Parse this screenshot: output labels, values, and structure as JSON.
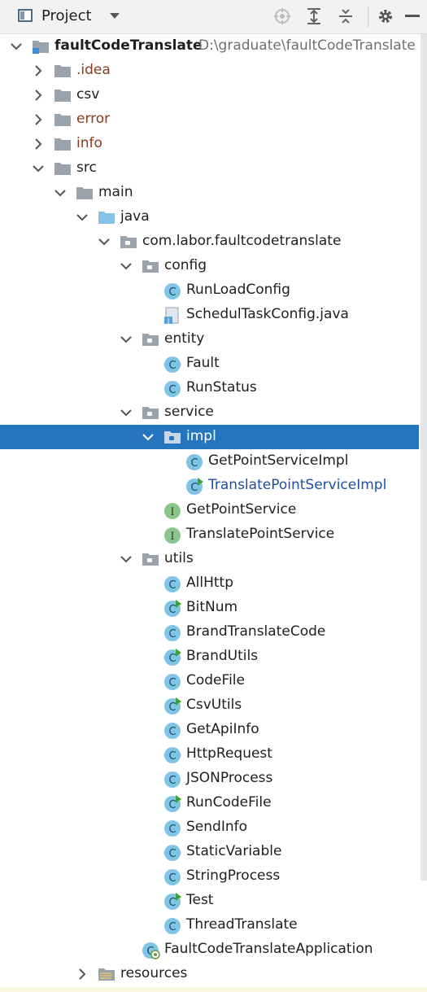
{
  "header": {
    "title": "Project"
  },
  "tree": [
    {
      "depth": 0,
      "state": "open",
      "icon": "module",
      "label": "faultCodeTranslate",
      "path": "D:\\graduate\\faultCodeTranslate",
      "style": "bold"
    },
    {
      "depth": 1,
      "state": "closed",
      "icon": "folder",
      "label": ".idea",
      "style": "red"
    },
    {
      "depth": 1,
      "state": "closed",
      "icon": "folder",
      "label": "csv",
      "style": "normal"
    },
    {
      "depth": 1,
      "state": "closed",
      "icon": "folder",
      "label": "error",
      "style": "red"
    },
    {
      "depth": 1,
      "state": "closed",
      "icon": "folder",
      "label": "info",
      "style": "red"
    },
    {
      "depth": 1,
      "state": "open",
      "icon": "folder",
      "label": "src",
      "style": "normal"
    },
    {
      "depth": 2,
      "state": "open",
      "icon": "folder",
      "label": "main",
      "style": "normal"
    },
    {
      "depth": 3,
      "state": "open",
      "icon": "source-folder",
      "label": "java",
      "style": "normal"
    },
    {
      "depth": 4,
      "state": "open",
      "icon": "package",
      "label": "com.labor.faultcodetranslate",
      "style": "normal"
    },
    {
      "depth": 5,
      "state": "open",
      "icon": "package",
      "label": "config",
      "style": "normal"
    },
    {
      "depth": 6,
      "state": "none",
      "icon": "class",
      "label": "RunLoadConfig",
      "style": "normal"
    },
    {
      "depth": 6,
      "state": "none",
      "icon": "java-file",
      "label": "SchedulTaskConfig.java",
      "style": "normal"
    },
    {
      "depth": 5,
      "state": "open",
      "icon": "package",
      "label": "entity",
      "style": "normal"
    },
    {
      "depth": 6,
      "state": "none",
      "icon": "class",
      "label": "Fault",
      "style": "normal"
    },
    {
      "depth": 6,
      "state": "none",
      "icon": "class",
      "label": "RunStatus",
      "style": "normal"
    },
    {
      "depth": 5,
      "state": "open",
      "icon": "package",
      "label": "service",
      "style": "normal"
    },
    {
      "depth": 6,
      "state": "open",
      "icon": "package",
      "label": "impl",
      "style": "normal",
      "selected": true
    },
    {
      "depth": 7,
      "state": "none",
      "icon": "class",
      "label": "GetPointServiceImpl",
      "style": "normal"
    },
    {
      "depth": 7,
      "state": "none",
      "icon": "class-runnable",
      "label": "TranslatePointServiceImpl",
      "style": "blue"
    },
    {
      "depth": 6,
      "state": "none",
      "icon": "interface",
      "label": "GetPointService",
      "style": "normal"
    },
    {
      "depth": 6,
      "state": "none",
      "icon": "interface",
      "label": "TranslatePointService",
      "style": "normal"
    },
    {
      "depth": 5,
      "state": "open",
      "icon": "package",
      "label": "utils",
      "style": "normal"
    },
    {
      "depth": 6,
      "state": "none",
      "icon": "class",
      "label": "AllHttp",
      "style": "normal"
    },
    {
      "depth": 6,
      "state": "none",
      "icon": "class-runnable",
      "label": "BitNum",
      "style": "normal"
    },
    {
      "depth": 6,
      "state": "none",
      "icon": "class",
      "label": "BrandTranslateCode",
      "style": "normal"
    },
    {
      "depth": 6,
      "state": "none",
      "icon": "class-runnable",
      "label": "BrandUtils",
      "style": "normal"
    },
    {
      "depth": 6,
      "state": "none",
      "icon": "class",
      "label": "CodeFile",
      "style": "normal"
    },
    {
      "depth": 6,
      "state": "none",
      "icon": "class-runnable",
      "label": "CsvUtils",
      "style": "normal"
    },
    {
      "depth": 6,
      "state": "none",
      "icon": "class",
      "label": "GetApiInfo",
      "style": "normal"
    },
    {
      "depth": 6,
      "state": "none",
      "icon": "class",
      "label": "HttpRequest",
      "style": "normal"
    },
    {
      "depth": 6,
      "state": "none",
      "icon": "class",
      "label": "JSONProcess",
      "style": "normal"
    },
    {
      "depth": 6,
      "state": "none",
      "icon": "class-runnable",
      "label": "RunCodeFile",
      "style": "normal"
    },
    {
      "depth": 6,
      "state": "none",
      "icon": "class",
      "label": "SendInfo",
      "style": "normal"
    },
    {
      "depth": 6,
      "state": "none",
      "icon": "class",
      "label": "StaticVariable",
      "style": "normal"
    },
    {
      "depth": 6,
      "state": "none",
      "icon": "class",
      "label": "StringProcess",
      "style": "normal"
    },
    {
      "depth": 6,
      "state": "none",
      "icon": "class-runnable",
      "label": "Test",
      "style": "normal"
    },
    {
      "depth": 6,
      "state": "none",
      "icon": "class",
      "label": "ThreadTranslate",
      "style": "normal"
    },
    {
      "depth": 5,
      "state": "none",
      "icon": "spring-boot-class",
      "label": "FaultCodeTranslateApplication",
      "style": "normal"
    },
    {
      "depth": 3,
      "state": "closed",
      "icon": "resources-folder",
      "label": "resources",
      "style": "normal"
    }
  ],
  "colors": {
    "selection": "#2675bf",
    "folder": "#9aa3ab",
    "source_folder": "#86c2e8",
    "class_badge": "#7fc4e6",
    "interface_badge": "#8cc58b"
  }
}
